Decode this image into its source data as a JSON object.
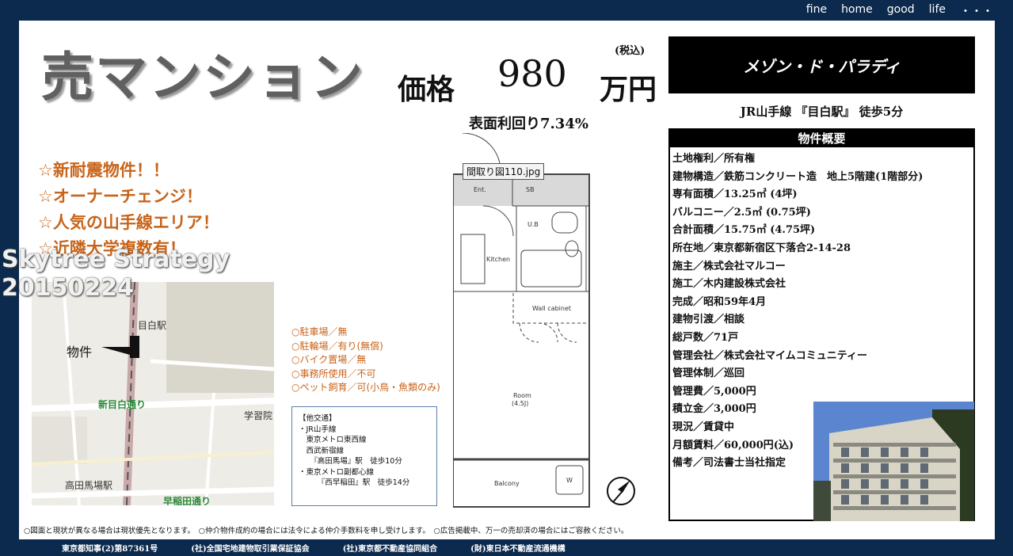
{
  "nav": [
    "fine",
    "home",
    "good",
    "life",
    "・・・"
  ],
  "headline": "売マンション",
  "price": {
    "label": "価格",
    "value": "980",
    "unit": "万円",
    "tax": "(税込)"
  },
  "yield": "表面利回り7.34%",
  "property_name": "メゾン・ド・パラディ",
  "station": "JR山手線 『目白駅』 徒歩5分",
  "spec": {
    "title": "物件概要",
    "rows": [
      "土地権利／所有権",
      "建物構造／鉄筋コンクリート造　地上5階建(1階部分)",
      "専有面積／13.25㎡ (4坪)",
      "バルコニー／2.5㎡ (0.75坪)",
      "合計面積／15.75㎡ (4.75坪)",
      "所在地／東京都新宿区下落合2-14-28",
      "施主／株式会社マルコー",
      "施工／木内建設株式会社",
      "完成／昭和59年4月",
      "建物引渡／相談",
      "総戸数／71戸",
      "管理会社／株式会社マイムコミュニティー",
      "管理体制／巡回",
      "管理費／5,000円",
      "積立金／3,000円",
      "現況／賃貸中",
      "月額賃料／60,000円(込)",
      "備考／司法書士当社指定"
    ]
  },
  "features": [
    "☆新耐震物件！！",
    "☆オーナーチェンジ！",
    "☆人気の山手線エリア！",
    "☆近隣大学複数有！"
  ],
  "watermark": [
    "Skytree Strategy",
    "20150224"
  ],
  "map": {
    "marker": "物件",
    "labels": [
      "目白駅",
      "新目白通り",
      "学習院",
      "高田馬場駅",
      "早稲田通り"
    ]
  },
  "facilities": [
    "○駐車場／無",
    "○駐輪場／有り(無償)",
    "○バイク置場／無",
    "○事務所使用／不可",
    "○ペット飼育／可(小鳥・魚類のみ)"
  ],
  "access": [
    "【他交通】",
    "・JR山手線",
    "　東京メトロ東西線",
    "　西武新宿線",
    "　　『高田馬場』駅　徒歩10分",
    "・東京メトロ副都心線",
    "　　　『西早稲田』駅　徒歩14分"
  ],
  "floorplan": {
    "tooltip": "間取り図110.jpg",
    "rooms": [
      "Ent.",
      "SB",
      "U.B",
      "Kitchen",
      "Wall cabinet",
      "Room",
      "(4.5J)",
      "Balcony",
      "W"
    ]
  },
  "disclaimer": "○図面と現状が異なる場合は現状優先となります。　○仲介物件成約の場合には法令による仲介手数料を申し受けします。　○広告掲載中、万一の売却済の場合にはご容赦ください。",
  "footer": [
    "東京都知事(2)第87361号",
    "(社)全国宅地建物取引業保証協会",
    "(社)東京都不動産協同組合",
    "(財)東日本不動産流通機構"
  ]
}
